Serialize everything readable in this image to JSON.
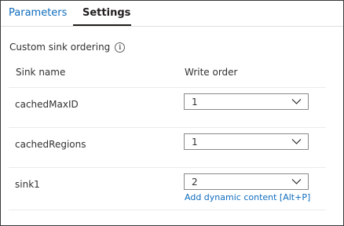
{
  "tabs": [
    {
      "label": "Parameters",
      "active": false
    },
    {
      "label": "Settings",
      "active": true
    }
  ],
  "section": {
    "title": "Custom sink ordering",
    "info_icon": "info-icon"
  },
  "table": {
    "columns": [
      "Sink name",
      "Write order"
    ],
    "rows": [
      {
        "name": "cachedMaxID",
        "order": "1"
      },
      {
        "name": "cachedRegions",
        "order": "1"
      },
      {
        "name": "sink1",
        "order": "2",
        "link": "Add dynamic content [Alt+P]"
      }
    ]
  },
  "colors": {
    "link": "#0f6cbd",
    "text": "#323130",
    "border": "#8a8886",
    "divider": "#edebe9"
  }
}
